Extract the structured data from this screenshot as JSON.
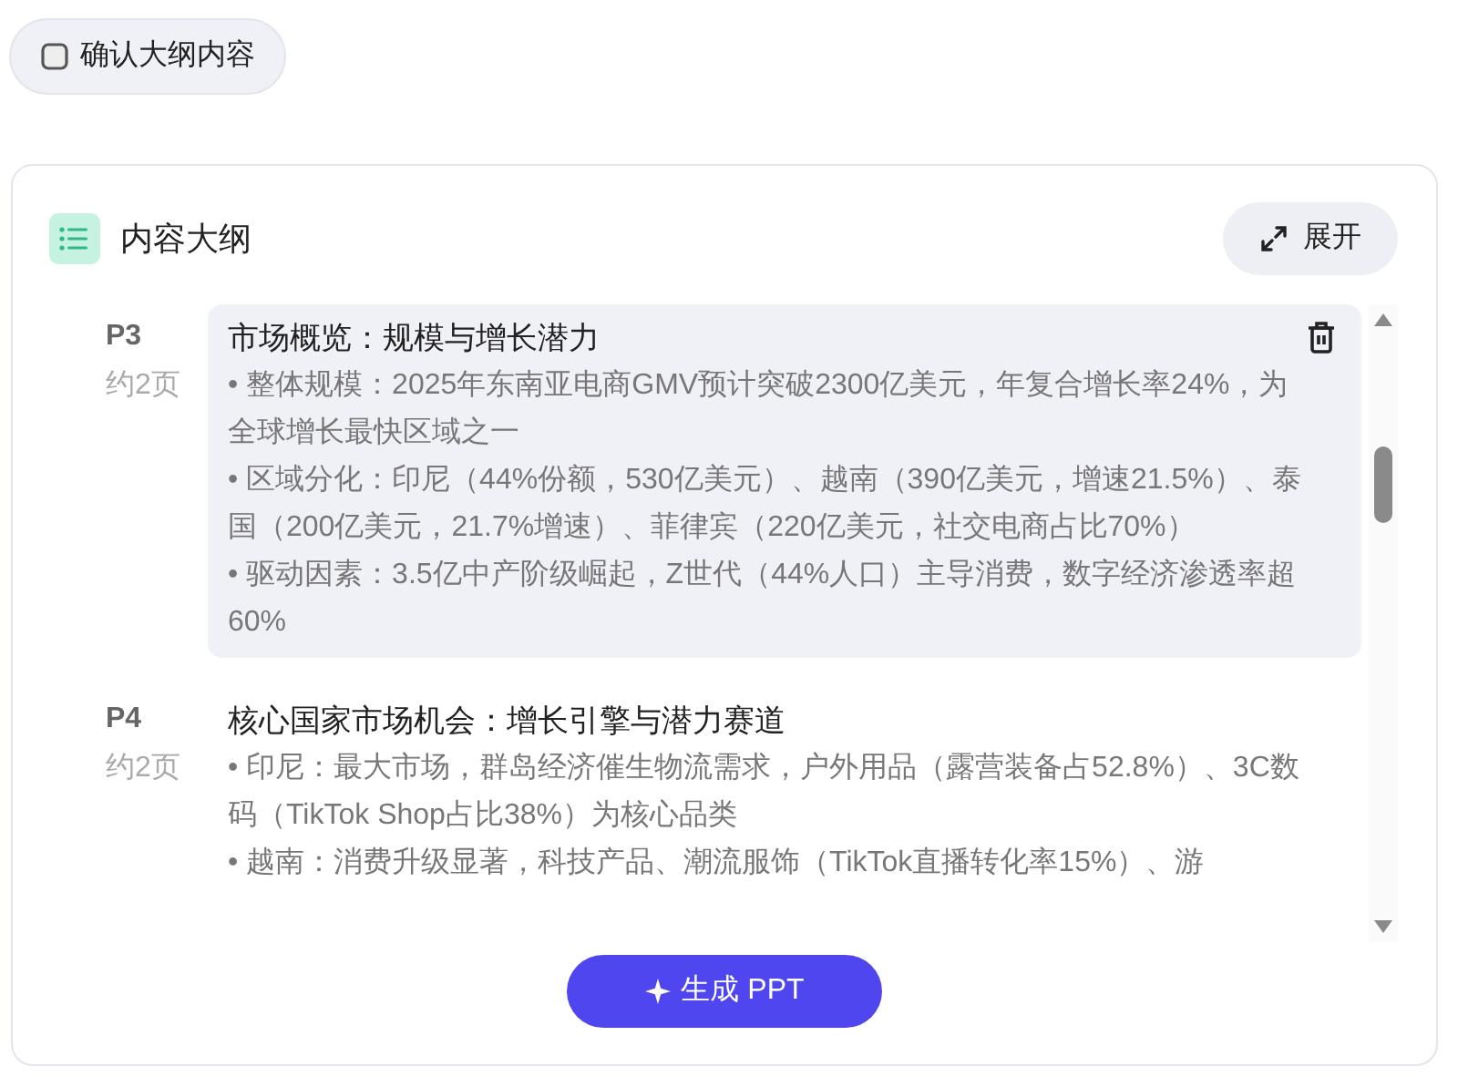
{
  "confirm_button": {
    "label": "确认大纲内容"
  },
  "outline": {
    "title": "内容大纲",
    "expand_button": {
      "label": "展开"
    },
    "sections": [
      {
        "page": "P3",
        "length": "约2页",
        "selected": true,
        "title": "市场概览：规模与增长潜力",
        "bullets": [
          "• 整体规模：2025年东南亚电商GMV预计突破2300亿美元，年复合增长率24%，为全球增长最快区域之一",
          "• 区域分化：印尼（44%份额，530亿美元）、越南（390亿美元，增速21.5%）、泰国（200亿美元，21.7%增速）、菲律宾（220亿美元，社交电商占比70%）",
          "• 驱动因素：3.5亿中产阶级崛起，Z世代（44%人口）主导消费，数字经济渗透率超60%"
        ]
      },
      {
        "page": "P4",
        "length": "约2页",
        "selected": false,
        "title": "核心国家市场机会：增长引擎与潜力赛道",
        "bullets": [
          "• 印尼：最大市场，群岛经济催生物流需求，户外用品（露营装备占52.8%）、3C数码（TikTok Shop占比38%）为核心品类",
          "• 越南：消费升级显著，科技产品、潮流服饰（TikTok直播转化率15%）、游"
        ]
      }
    ],
    "generate_button": {
      "label": "生成 PPT"
    }
  }
}
